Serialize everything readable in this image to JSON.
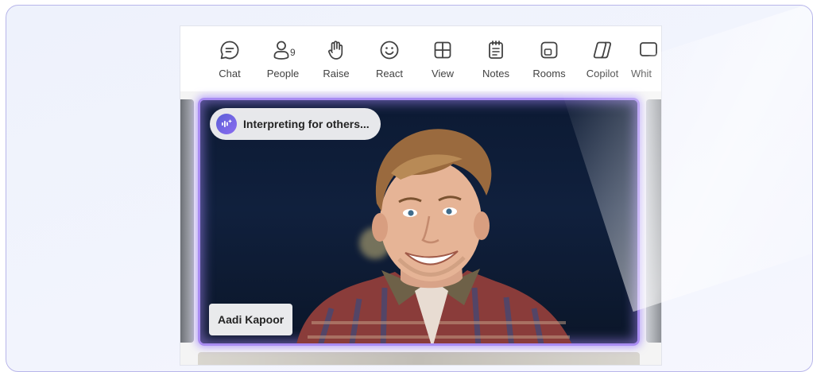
{
  "toolbar": {
    "items": [
      {
        "label": "Chat",
        "icon": "chat-icon"
      },
      {
        "label": "People",
        "icon": "people-icon",
        "count": "9"
      },
      {
        "label": "Raise",
        "icon": "raise-hand-icon"
      },
      {
        "label": "React",
        "icon": "react-smiley-icon"
      },
      {
        "label": "View",
        "icon": "view-grid-icon"
      },
      {
        "label": "Notes",
        "icon": "notes-icon"
      },
      {
        "label": "Rooms",
        "icon": "rooms-icon"
      },
      {
        "label": "Copilot",
        "icon": "copilot-icon"
      },
      {
        "label": "Whit",
        "icon": "whiteboard-icon"
      }
    ]
  },
  "video": {
    "status_badge": "Interpreting for others...",
    "participant_name": "Aadi Kapoor",
    "accent_color": "#a98cf2"
  }
}
